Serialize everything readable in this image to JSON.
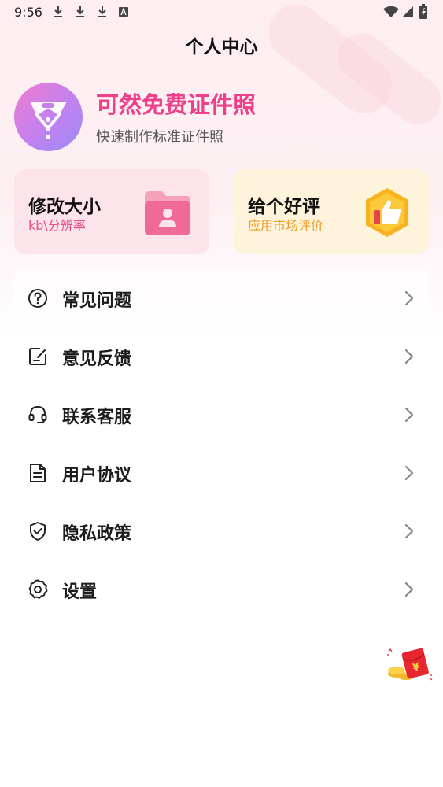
{
  "status_bar": {
    "time": "9:56"
  },
  "header": {
    "title": "个人中心"
  },
  "profile": {
    "app_name": "可然免费证件照",
    "tagline": "快速制作标准证件照"
  },
  "cards": [
    {
      "title": "修改大小",
      "subtitle": "kb\\分辨率",
      "icon": "pink-folder-person-icon"
    },
    {
      "title": "给个好评",
      "subtitle": "应用市场评价",
      "icon": "thumbs-up-hexagon-icon"
    }
  ],
  "menu": {
    "items": [
      {
        "label": "常见问题",
        "icon": "question-circle-icon"
      },
      {
        "label": "意见反馈",
        "icon": "feedback-edit-icon"
      },
      {
        "label": "联系客服",
        "icon": "headset-icon"
      },
      {
        "label": "用户协议",
        "icon": "document-icon"
      },
      {
        "label": "隐私政策",
        "icon": "shield-check-icon"
      },
      {
        "label": "设置",
        "icon": "gear-icon"
      }
    ]
  },
  "floating": {
    "icon": "red-envelope-icon"
  },
  "colors": {
    "accent_pink": "#ee3f8a",
    "accent_orange": "#f29a22",
    "card_pink_bg": "#fde3ea",
    "card_yellow_bg": "#fef4db"
  }
}
